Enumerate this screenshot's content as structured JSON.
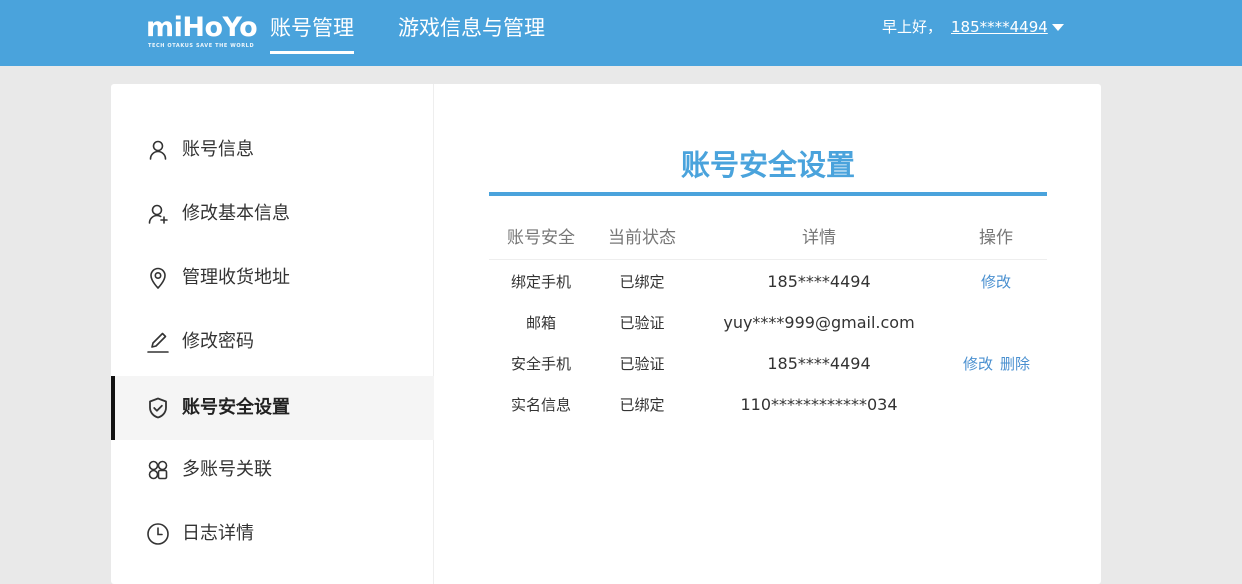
{
  "header": {
    "logo_text": "miHoYo",
    "logo_tagline": "TECH OTAKUS SAVE THE WORLD",
    "tabs": [
      {
        "label": "账号管理",
        "active": true
      },
      {
        "label": "游戏信息与管理",
        "active": false
      }
    ],
    "greeting": "早上好，",
    "username": "185****4494",
    "bg_color": "#4aa3dc"
  },
  "sidebar": {
    "items": [
      {
        "label": "账号信息",
        "icon": "user-icon",
        "active": false
      },
      {
        "label": "修改基本信息",
        "icon": "user-add-icon",
        "active": false
      },
      {
        "label": "管理收货地址",
        "icon": "location-pin-icon",
        "active": false
      },
      {
        "label": "修改密码",
        "icon": "pencil-icon",
        "active": false
      },
      {
        "label": "账号安全设置",
        "icon": "shield-check-icon",
        "active": true
      },
      {
        "label": "多账号关联",
        "icon": "accounts-link-icon",
        "active": false
      },
      {
        "label": "日志详情",
        "icon": "clock-icon",
        "active": false
      }
    ]
  },
  "main": {
    "title": "账号安全设置",
    "accent_color": "#4aa3dc",
    "table": {
      "headers": [
        "账号安全",
        "当前状态",
        "详情",
        "操作"
      ],
      "rows": [
        {
          "item": "绑定手机",
          "status": "已绑定",
          "detail": "185****4494",
          "actions": [
            "修改"
          ]
        },
        {
          "item": "邮箱",
          "status": "已验证",
          "detail": "yuy****999@gmail.com",
          "actions": []
        },
        {
          "item": "安全手机",
          "status": "已验证",
          "detail": "185****4494",
          "actions": [
            "修改",
            "删除"
          ]
        },
        {
          "item": "实名信息",
          "status": "已绑定",
          "detail": "110************034",
          "actions": []
        }
      ]
    }
  }
}
